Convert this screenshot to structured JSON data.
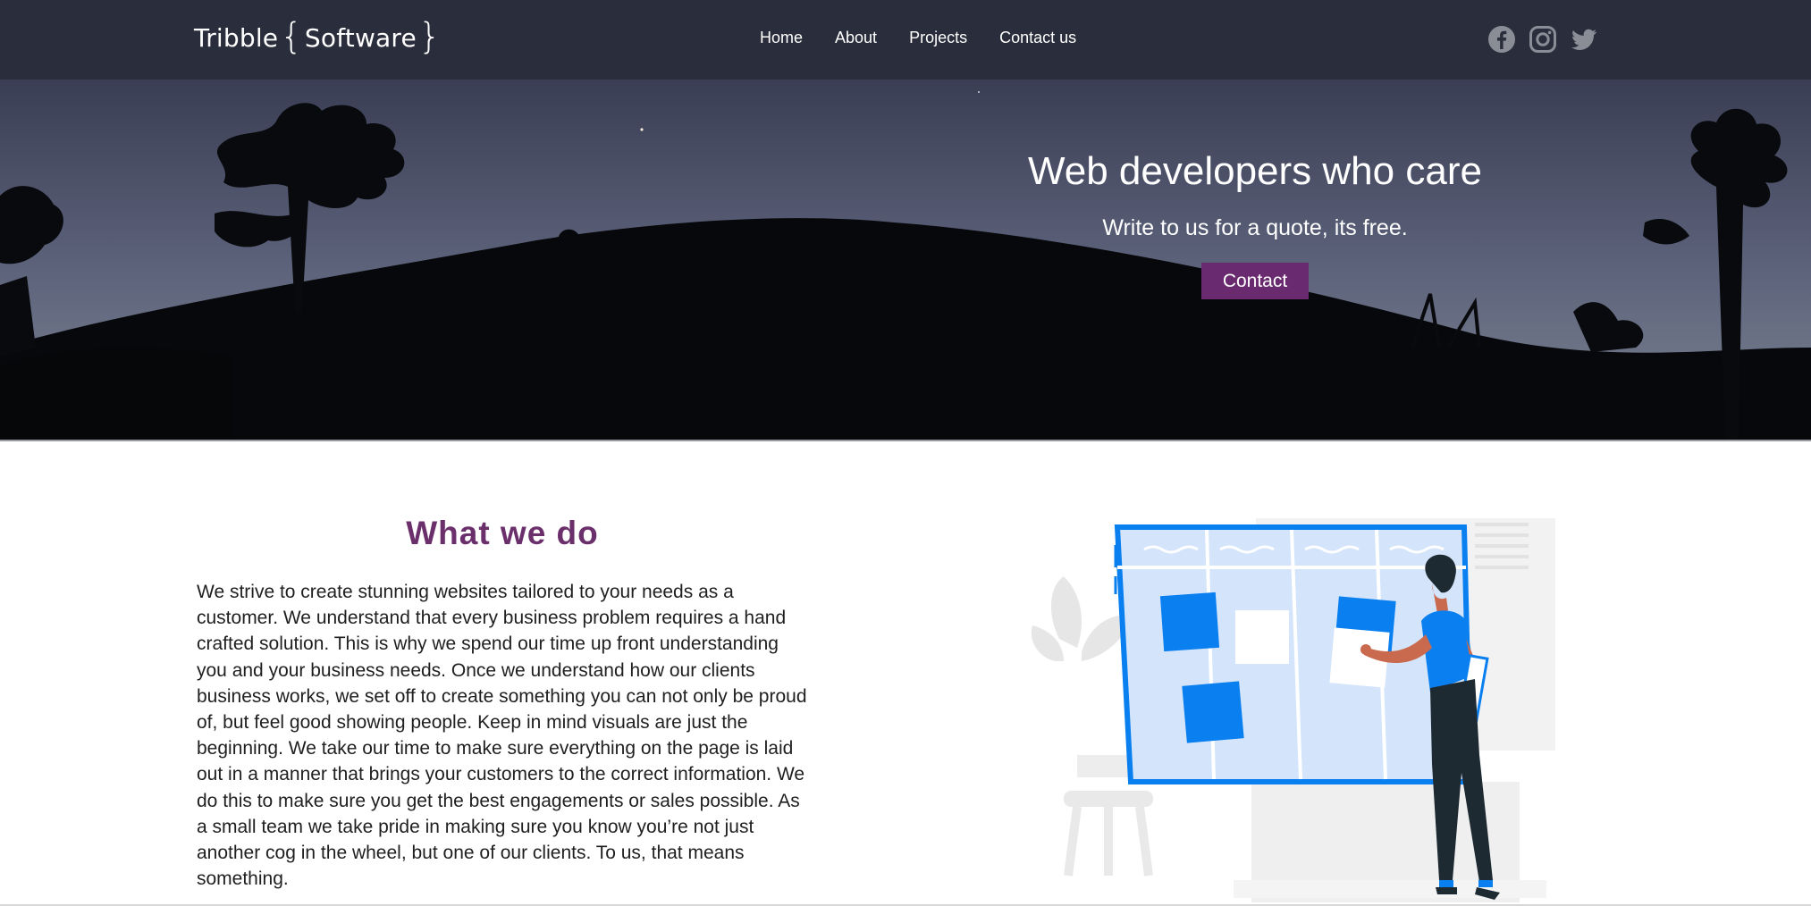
{
  "brand": {
    "name_before": "Tribble",
    "brace_open": "{",
    "name_inner": "Software",
    "brace_close": "}"
  },
  "nav": {
    "items": [
      {
        "label": "Home"
      },
      {
        "label": "About"
      },
      {
        "label": "Projects"
      },
      {
        "label": "Contact us"
      }
    ]
  },
  "socials": [
    "facebook-icon",
    "instagram-icon",
    "twitter-icon"
  ],
  "hero": {
    "title": "Web developers who care",
    "subtitle": "Write to us for a quote, its free.",
    "button_label": "Contact"
  },
  "about": {
    "title": "What we do",
    "body": "We strive to create stunning websites tailored to your needs as a customer. We understand that every business problem requires a hand crafted solution. This is why we spend our time up front understanding you and your business needs. Once we understand how our clients business works, we set off to create something you can not only be proud of, but feel good showing people. Keep in mind visuals are just the beginning. We take our time to make sure everything on the page is laid out in a manner that brings your customers to the correct information. We do this to make sure you get the best engagements or sales possible. As a small team we take pride in making sure you know you’re not just another cog in the wheel, but one of our clients. To us, that means something."
  },
  "colors": {
    "navbar_bg": "#2a2d3b",
    "accent_purple": "#6a2a6f",
    "heading_purple": "#6b2f6c",
    "illustration_blue": "#0a7ff0"
  }
}
